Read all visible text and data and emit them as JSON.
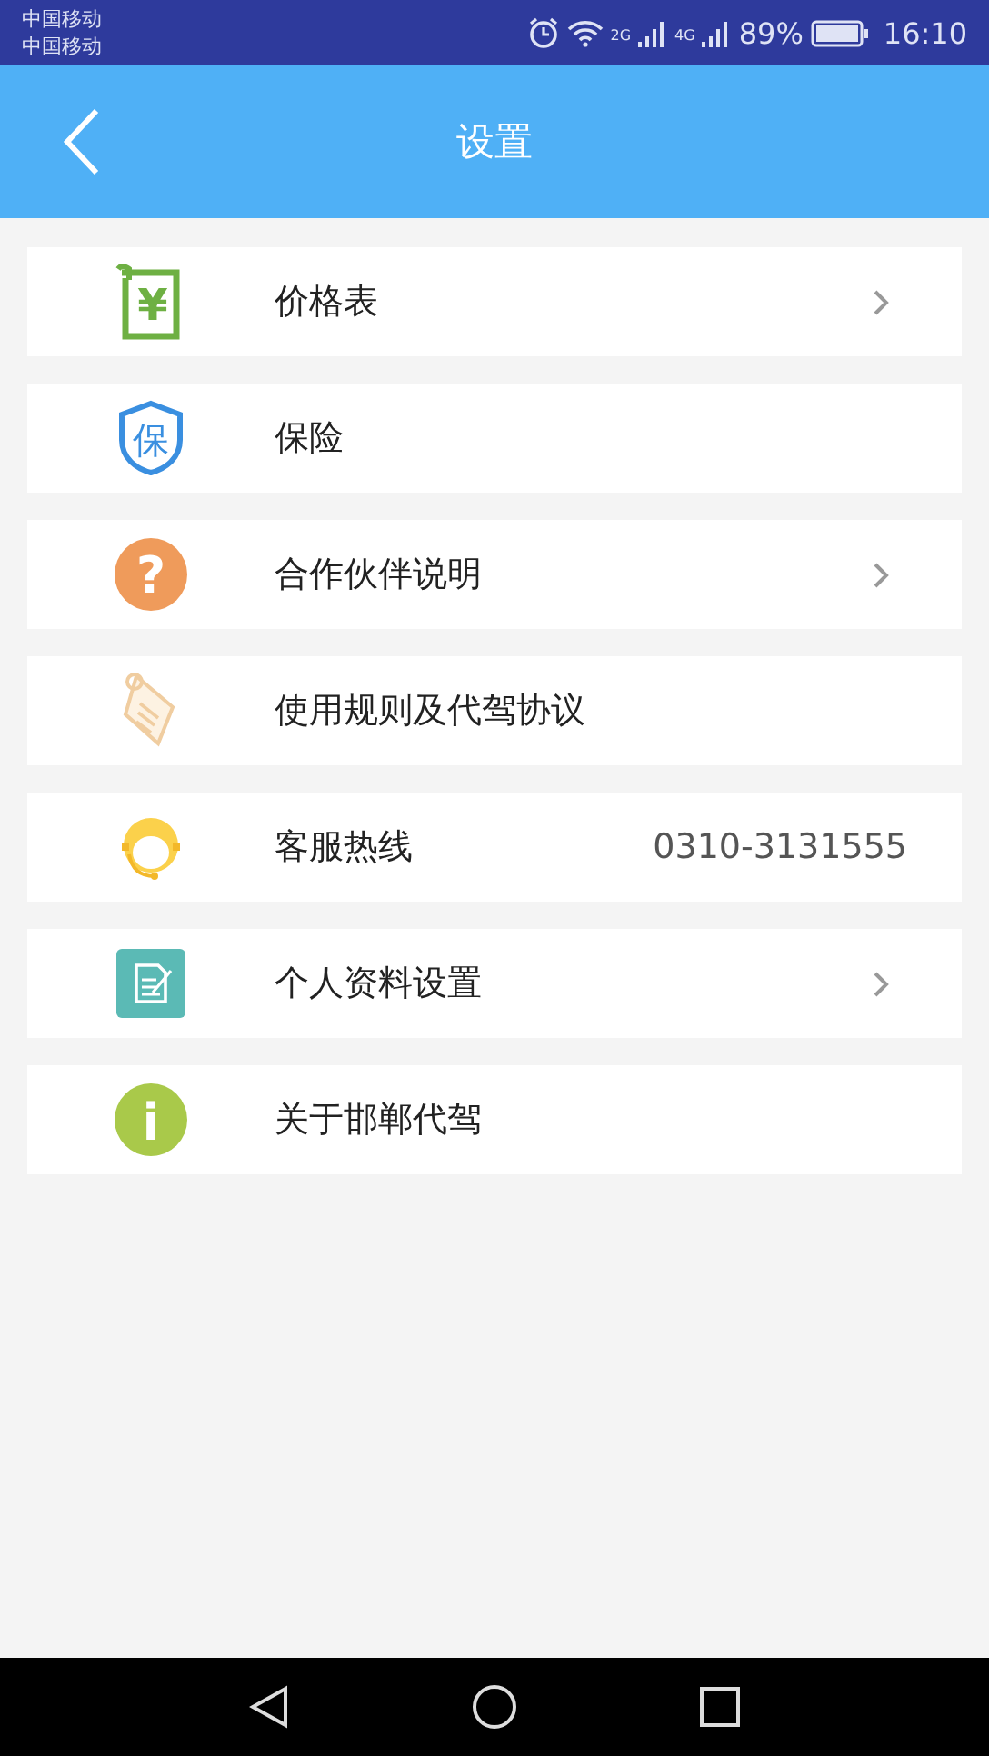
{
  "status_bar": {
    "carriers": [
      "中国移动",
      "中国移动"
    ],
    "network_labels": [
      "2G",
      "4G"
    ],
    "battery": "89%",
    "time": "16:10"
  },
  "header": {
    "title": "设置"
  },
  "items": [
    {
      "kind": "price",
      "glyph": "¥",
      "label": "价格表",
      "chevron": true
    },
    {
      "kind": "insurance",
      "glyph": "保",
      "label": "保险",
      "chevron": false
    },
    {
      "kind": "help",
      "glyph": "?",
      "label": "合作伙伴说明",
      "chevron": true
    },
    {
      "kind": "scroll",
      "label": "使用规则及代驾协议",
      "chevron": false
    },
    {
      "kind": "headset",
      "label": "客服热线",
      "value": "0310-3131555",
      "chevron": false
    },
    {
      "kind": "edit",
      "label": "个人资料设置",
      "chevron": true
    },
    {
      "kind": "info",
      "glyph": "i",
      "label": "关于邯郸代驾",
      "chevron": false
    }
  ]
}
